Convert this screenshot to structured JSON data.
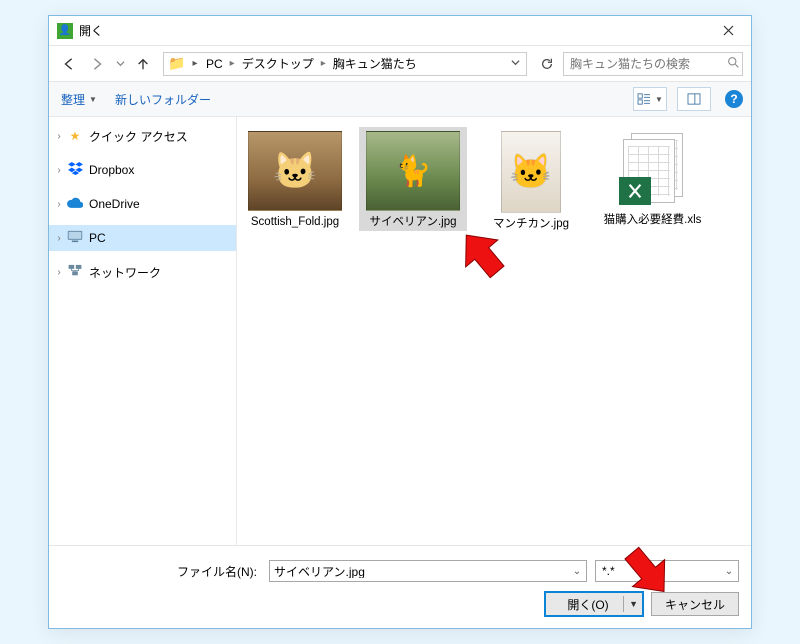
{
  "title": "開く",
  "nav": {
    "back_enabled": true,
    "fwd_enabled": false,
    "breadcrumb": [
      "PC",
      "デスクトップ",
      "胸キュン猫たち"
    ],
    "search_placeholder": "胸キュン猫たちの検索"
  },
  "toolbar": {
    "organize": "整理",
    "newfolder": "新しいフォルダー"
  },
  "tree": {
    "items": [
      {
        "icon": "star",
        "label": "クイック アクセス",
        "expandable": true
      },
      {
        "icon": "dropbox",
        "label": "Dropbox",
        "expandable": true
      },
      {
        "icon": "onedrive",
        "label": "OneDrive",
        "expandable": true
      },
      {
        "icon": "pc",
        "label": "PC",
        "expandable": true,
        "selected": true
      },
      {
        "icon": "network",
        "label": "ネットワーク",
        "expandable": true
      }
    ]
  },
  "files": [
    {
      "name": "Scottish_Fold.jpg",
      "kind": "img",
      "thumb": "cat1"
    },
    {
      "name": "サイベリアン.jpg",
      "kind": "img",
      "thumb": "cat2",
      "selected": true
    },
    {
      "name": "マンチカン.jpg",
      "kind": "img",
      "thumb": "cat3",
      "tall": true
    },
    {
      "name": "猫購入必要経費.xls",
      "kind": "xls"
    }
  ],
  "bottom": {
    "filename_label": "ファイル名(N):",
    "filename_value": "サイベリアン.jpg",
    "filetype_value": "*.*",
    "open_label": "開く(O)",
    "cancel_label": "キャンセル"
  }
}
